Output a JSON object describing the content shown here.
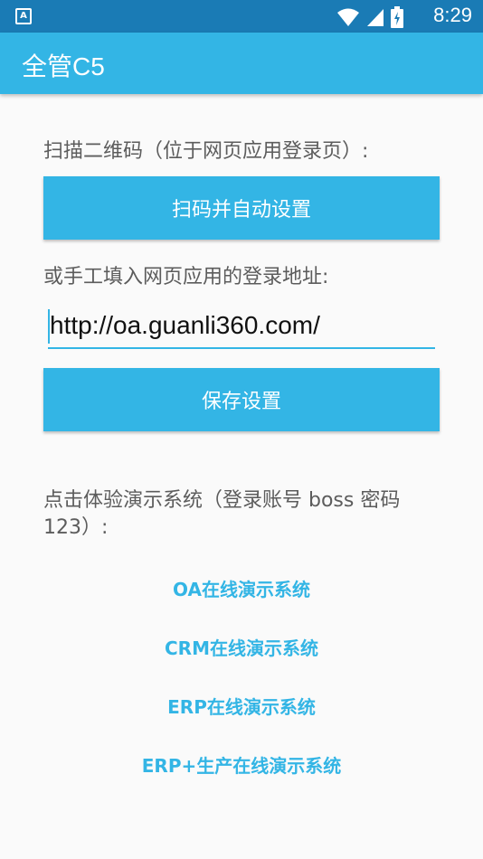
{
  "status_bar": {
    "notification_icon": "font-a-icon",
    "notification_glyph": "A",
    "time": "8:29"
  },
  "app_bar": {
    "title": "全管C5"
  },
  "scan": {
    "label": "扫描二维码（位于网页应用登录页）:",
    "button": "扫码并自动设置"
  },
  "manual": {
    "label": "或手工填入网页应用的登录地址:",
    "url_value": "http://oa.guanli360.com/"
  },
  "save_button": "保存设置",
  "demo": {
    "label_line1": "点击体验演示系统（登录账号 boss 密码",
    "label_line2": "123）:",
    "links": [
      "OA在线演示系统",
      "CRM在线演示系统",
      "ERP在线演示系统",
      "ERP+生产在线演示系统"
    ]
  },
  "colors": {
    "status_bar": "#1a7bb5",
    "accent": "#33b5e5",
    "label_text": "#5c5c5c"
  }
}
